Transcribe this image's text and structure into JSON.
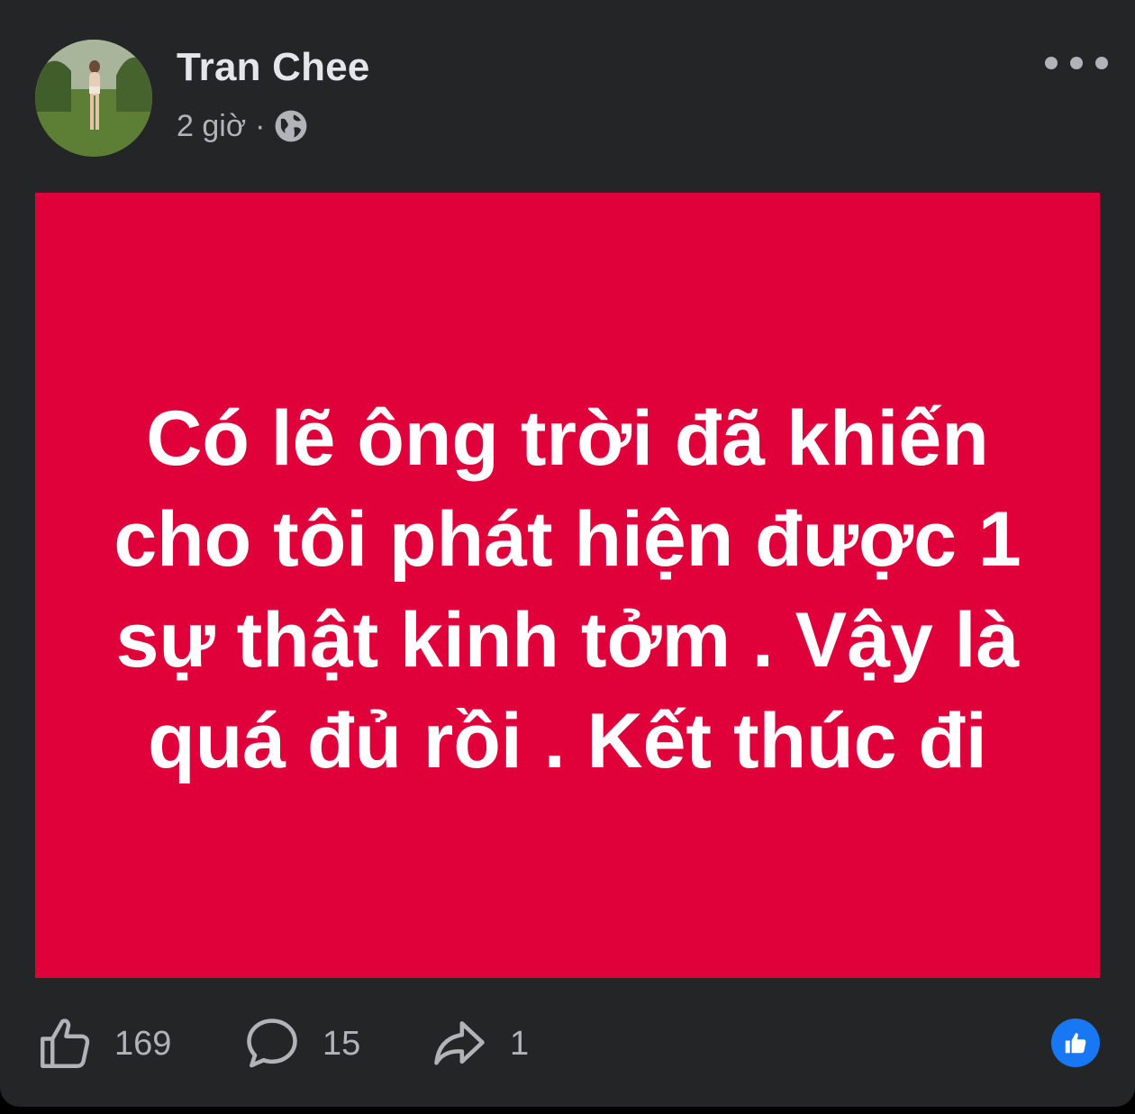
{
  "post": {
    "author_name": "Tran Chee",
    "timestamp": "2 giờ",
    "separator": "·",
    "privacy_icon": "globe-icon",
    "more_icon": "more-horizontal-icon",
    "background_color": "#e0003a",
    "text": "Có lẽ ông trời đã khiến cho tôi phát hiện được 1 sự thật kinh tởm . Vậy là quá đủ rồi . Kết thúc đi"
  },
  "actions": {
    "like_count": "169",
    "comment_count": "15",
    "share_count": "1",
    "like_icon": "thumbs-up-outline-icon",
    "comment_icon": "comment-bubble-icon",
    "share_icon": "share-arrow-icon",
    "reaction_icon": "like-reaction-icon",
    "reaction_color": "#1877f2"
  }
}
